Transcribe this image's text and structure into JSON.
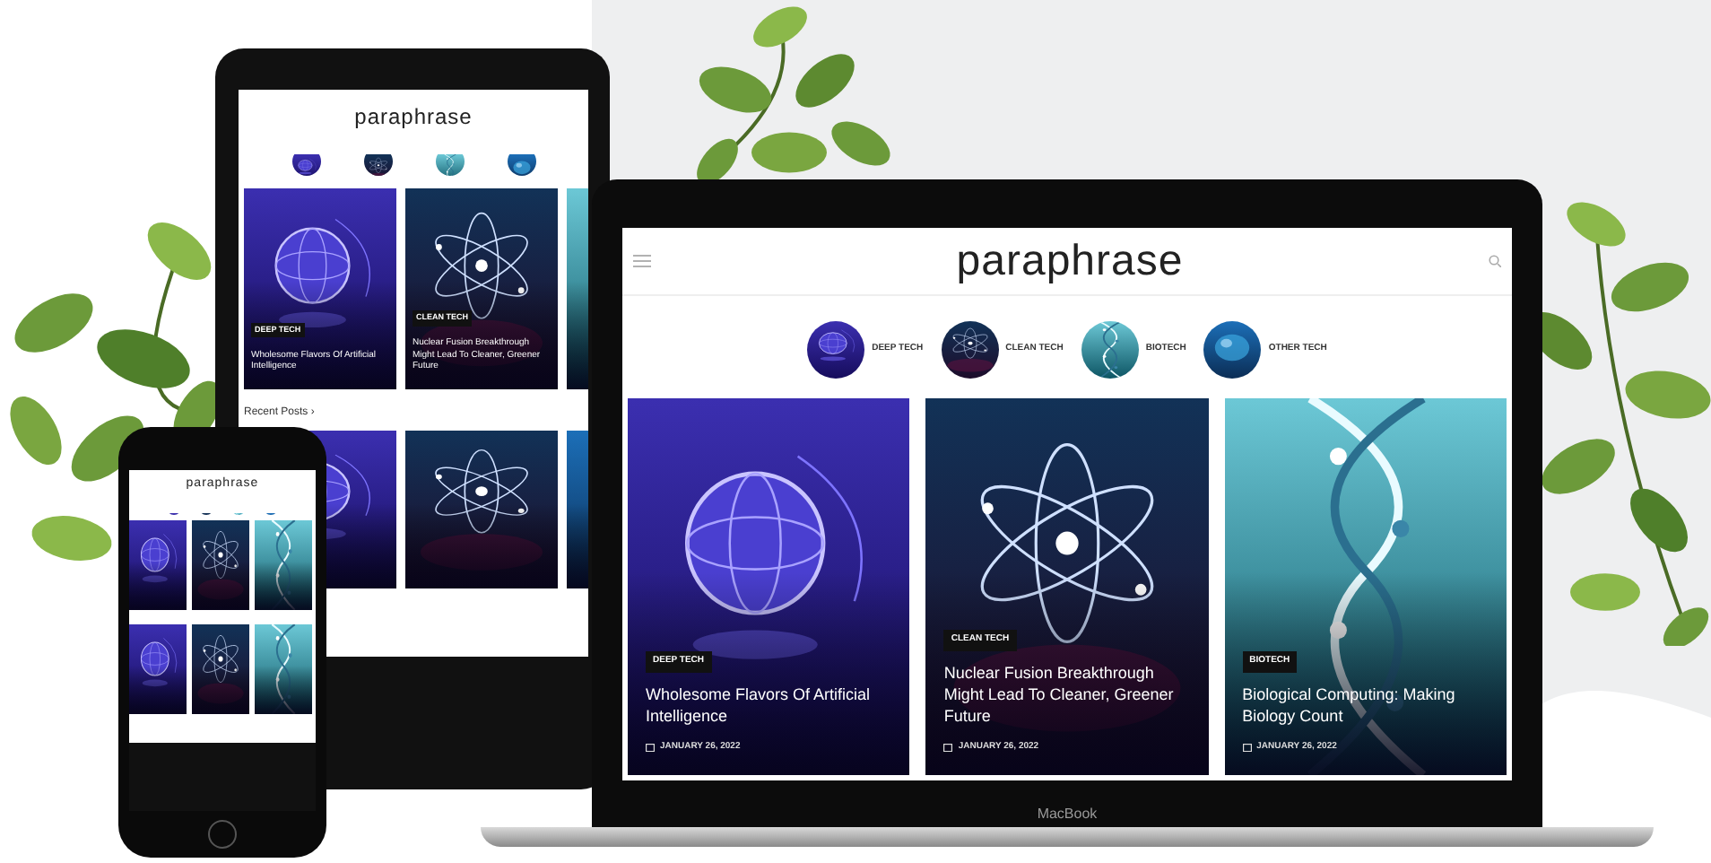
{
  "tablet": {
    "site": {
      "logo": "paraphrase",
      "posts": [
        {
          "tag": "DEEP TECH",
          "title": "Wholesome Flavors Of Artificial Intelligence"
        },
        {
          "tag": "CLEAN TECH",
          "title": "Nuclear Fusion Breakthrough Might Lead To Cleaner, Greener Future"
        }
      ],
      "section_title": "Recent Posts ›"
    }
  },
  "phone": {
    "site": {
      "logo": "paraphrase"
    }
  },
  "laptop": {
    "brand": "MacBook",
    "site": {
      "logo": "paraphrase",
      "categories": [
        {
          "label": "DEEP TECH"
        },
        {
          "label": "CLEAN TECH"
        },
        {
          "label": "BIOTECH"
        },
        {
          "label": "OTHER TECH"
        }
      ],
      "posts": [
        {
          "tag": "DEEP TECH",
          "title": "Wholesome Flavors Of Artificial Intelligence",
          "date": "JANUARY 26, 2022"
        },
        {
          "tag": "CLEAN TECH",
          "title": "Nuclear Fusion Breakthrough Might Lead To Cleaner, Greener Future",
          "date": "JANUARY 26, 2022"
        },
        {
          "tag": "BIOTECH",
          "title": "Biological Computing: Making Biology Count",
          "date": "JANUARY 26, 2022"
        }
      ]
    }
  }
}
